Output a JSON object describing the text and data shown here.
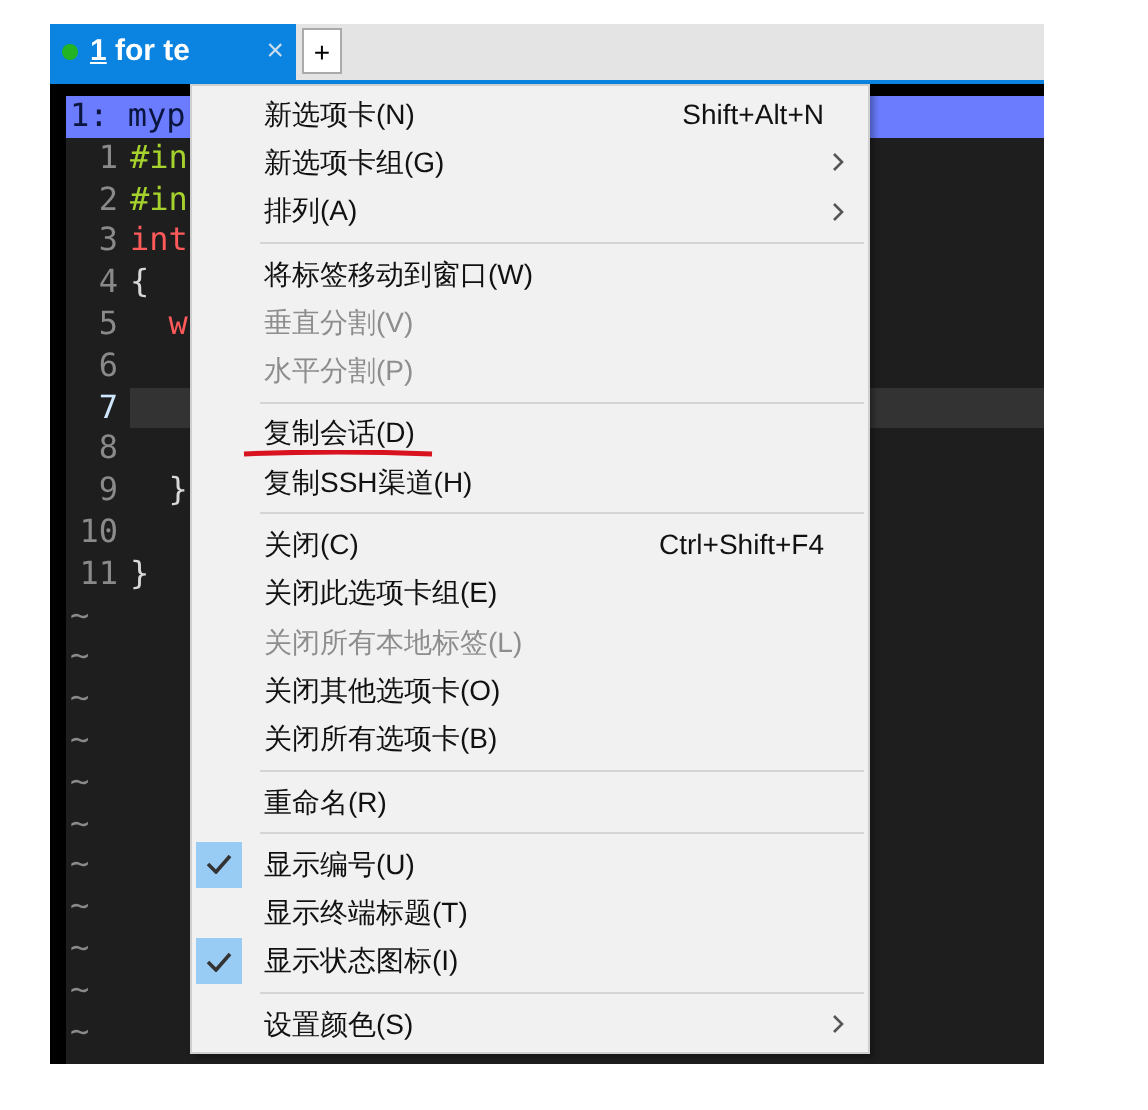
{
  "tab": {
    "number": "1",
    "label": "for te",
    "color": "#22b422",
    "selected": true,
    "close": "×",
    "add": "+"
  },
  "terminal": {
    "header": "1: myp",
    "lines": [
      {
        "number": "1",
        "current": false,
        "tokens": [
          {
            "kind": "preprocessor",
            "text": "#in"
          }
        ]
      },
      {
        "number": "2",
        "current": false,
        "tokens": [
          {
            "kind": "preprocessor",
            "text": "#in"
          }
        ]
      },
      {
        "number": "3",
        "current": false,
        "tokens": [
          {
            "kind": "keyword",
            "text": "int"
          }
        ]
      },
      {
        "number": "4",
        "current": false,
        "tokens": [
          {
            "kind": "plain",
            "text": "{"
          }
        ]
      },
      {
        "number": "5",
        "current": false,
        "tokens": [
          {
            "kind": "keyword",
            "text": "  w"
          }
        ]
      },
      {
        "number": "6",
        "current": false
      },
      {
        "number": "7",
        "current": true
      },
      {
        "number": "8",
        "current": false
      },
      {
        "number": "9",
        "current": false,
        "tokens": [
          {
            "kind": "plain",
            "text": "  }"
          }
        ]
      },
      {
        "number": "10",
        "current": false
      },
      {
        "number": "11",
        "current": false,
        "tokens": [
          {
            "kind": "plain",
            "text": "}"
          }
        ]
      }
    ],
    "empty_rows": [
      "~",
      "~",
      "~",
      "~",
      "~",
      "~",
      "~",
      "~",
      "~",
      "~",
      "~"
    ]
  },
  "menu": [
    {
      "kind": "item",
      "label": "新选项卡(N)",
      "shortcut": "Shift+Alt+N",
      "disabled": false,
      "checked": false,
      "submenu": false
    },
    {
      "kind": "item",
      "label": "新选项卡组(G)",
      "disabled": false,
      "checked": false,
      "submenu": true
    },
    {
      "kind": "item",
      "label": "排列(A)",
      "disabled": false,
      "checked": false,
      "submenu": true
    },
    {
      "kind": "separator"
    },
    {
      "kind": "item",
      "label": "将标签移动到窗口(W)",
      "disabled": false,
      "checked": false,
      "submenu": false
    },
    {
      "kind": "item",
      "label": "垂直分割(V)",
      "disabled": true,
      "checked": false,
      "submenu": false
    },
    {
      "kind": "item",
      "label": "水平分割(P)",
      "disabled": true,
      "checked": false,
      "submenu": false
    },
    {
      "kind": "separator"
    },
    {
      "kind": "item",
      "label": "复制会话(D)",
      "disabled": false,
      "checked": false,
      "submenu": false,
      "annotated": true
    },
    {
      "kind": "item",
      "label": "复制SSH渠道(H)",
      "disabled": false,
      "checked": false,
      "submenu": false
    },
    {
      "kind": "separator"
    },
    {
      "kind": "item",
      "label": "关闭(C)",
      "shortcut": "Ctrl+Shift+F4",
      "disabled": false,
      "checked": false,
      "submenu": false
    },
    {
      "kind": "item",
      "label": "关闭此选项卡组(E)",
      "disabled": false,
      "checked": false,
      "submenu": false
    },
    {
      "kind": "item",
      "label": "关闭所有本地标签(L)",
      "disabled": true,
      "checked": false,
      "submenu": false
    },
    {
      "kind": "item",
      "label": "关闭其他选项卡(O)",
      "disabled": false,
      "checked": false,
      "submenu": false
    },
    {
      "kind": "item",
      "label": "关闭所有选项卡(B)",
      "disabled": false,
      "checked": false,
      "submenu": false
    },
    {
      "kind": "separator"
    },
    {
      "kind": "item",
      "label": "重命名(R)",
      "disabled": false,
      "checked": false,
      "submenu": false
    },
    {
      "kind": "separator"
    },
    {
      "kind": "item",
      "label": "显示编号(U)",
      "disabled": false,
      "checked": true,
      "submenu": false
    },
    {
      "kind": "item",
      "label": "显示终端标题(T)",
      "disabled": false,
      "checked": false,
      "submenu": false
    },
    {
      "kind": "item",
      "label": "显示状态图标(I)",
      "disabled": false,
      "checked": true,
      "submenu": false
    },
    {
      "kind": "separator"
    },
    {
      "kind": "item",
      "label": "设置颜色(S)",
      "disabled": false,
      "checked": false,
      "submenu": true
    }
  ]
}
